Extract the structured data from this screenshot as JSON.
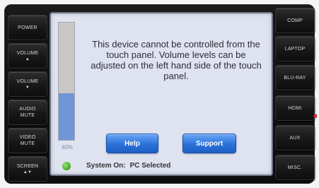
{
  "left_buttons": [
    {
      "label": "POWER",
      "arrow": ""
    },
    {
      "label": "VOLUME",
      "arrow": "▲"
    },
    {
      "label": "VOLUME",
      "arrow": "▼"
    },
    {
      "label": "AUDIO\nMUTE",
      "arrow": ""
    },
    {
      "label": "VIDEO\nMUTE",
      "arrow": ""
    },
    {
      "label": "SCREEN",
      "arrow": "▲▼"
    }
  ],
  "right_buttons": [
    {
      "label": "COMP"
    },
    {
      "label": "LAPTOP"
    },
    {
      "label": "BLU-RAY"
    },
    {
      "label": "HDMI"
    },
    {
      "label": "AUX"
    },
    {
      "label": "MISC."
    }
  ],
  "screen": {
    "message": "This device cannot be controlled from the touch panel.  Volume levels can be adjusted on the left hand side of the touch panel.",
    "volume_percent_label": "40%",
    "volume_level": 0.4,
    "help_label": "Help",
    "support_label": "Support",
    "status_label": "System On:",
    "status_value": "PC Selected"
  },
  "colors": {
    "meter_fill": "#6f95d6",
    "status_led": "#4fb02e",
    "button_blue": "#2a71da",
    "pointer": "#d8232a"
  }
}
